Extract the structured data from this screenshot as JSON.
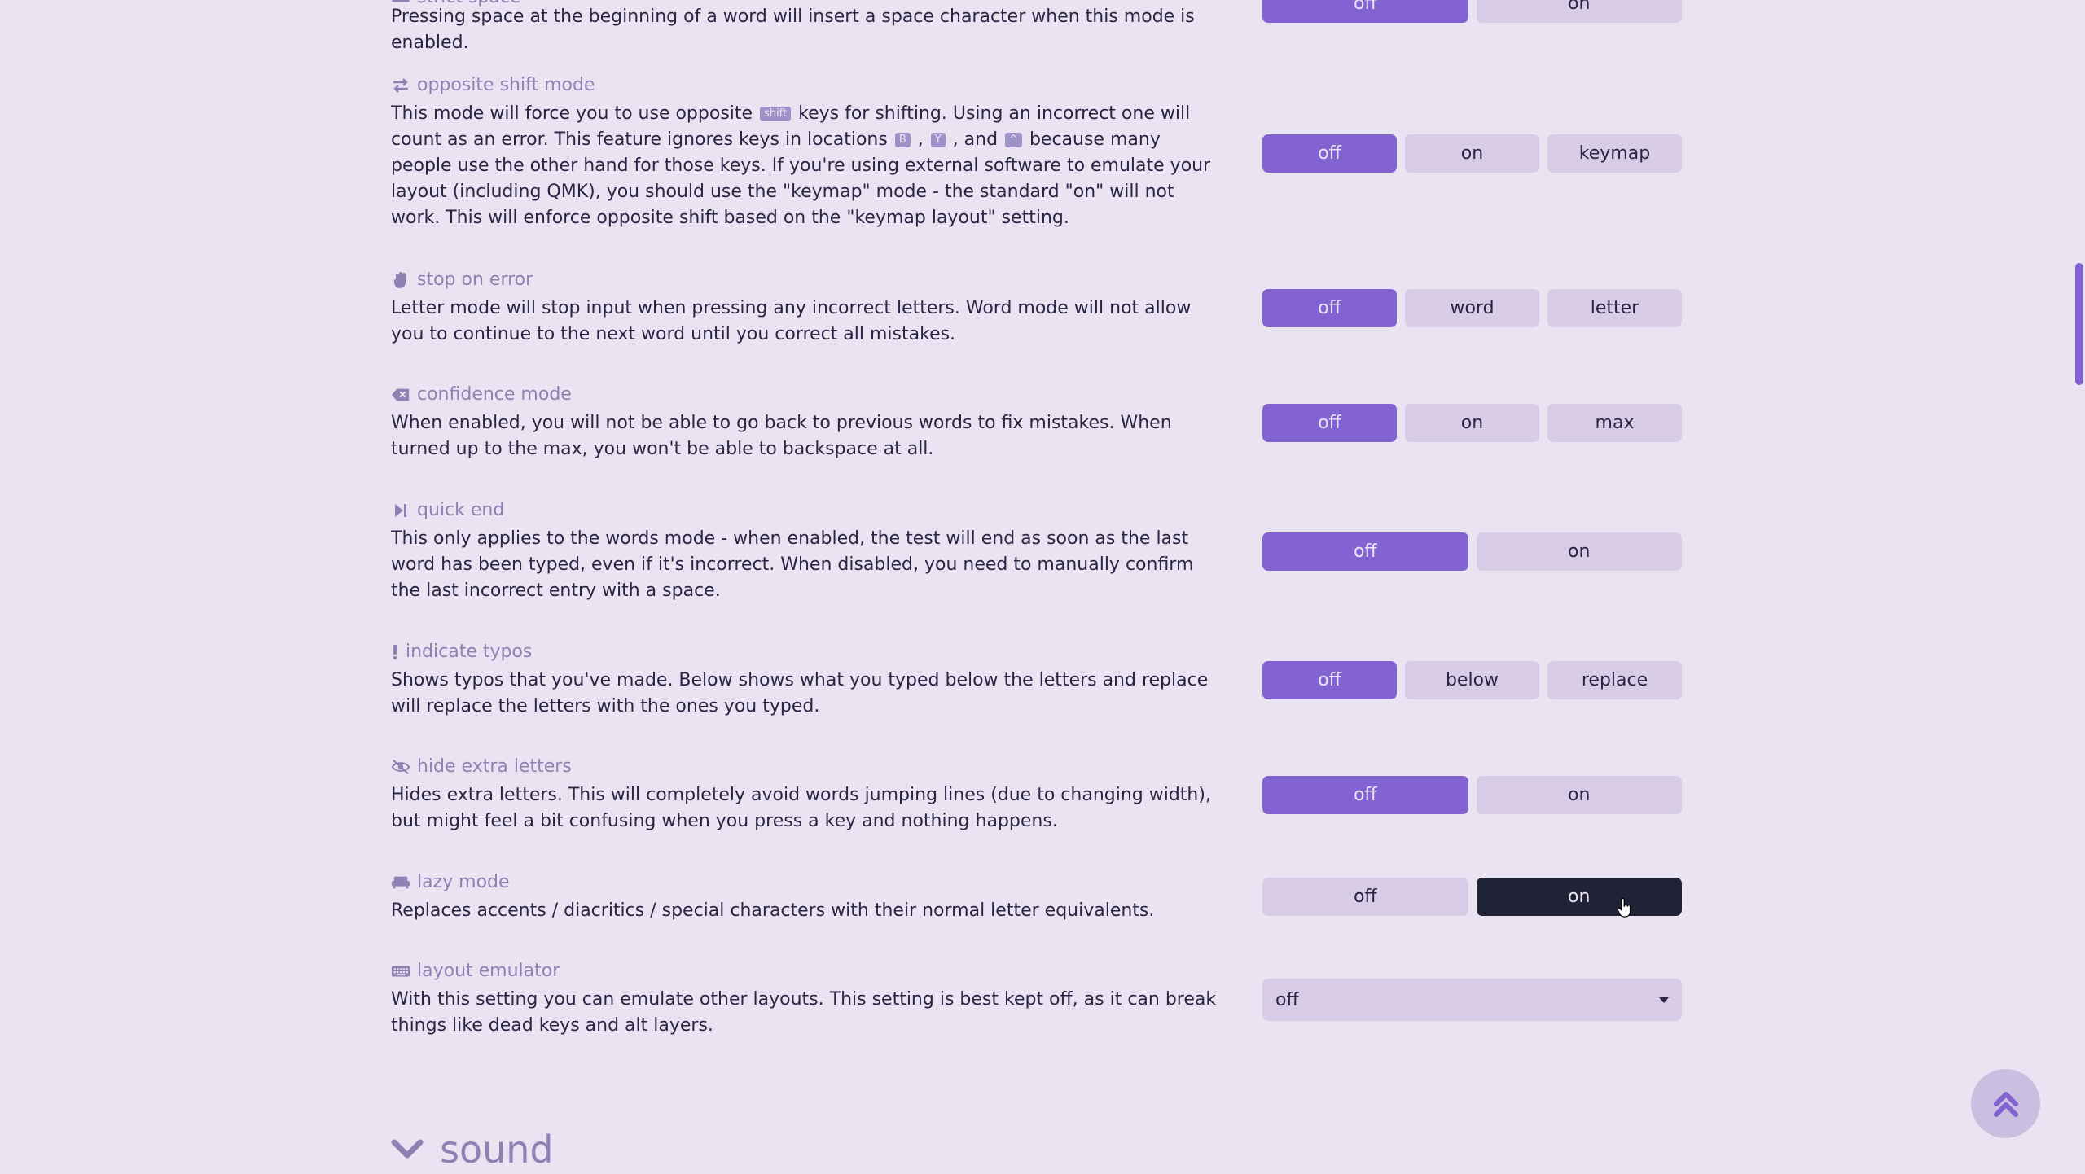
{
  "settings": [
    {
      "title": "strict space",
      "icon": "strict-space-icon",
      "description": "Pressing space at the beginning of a word will insert a space character when this mode is enabled.",
      "options": [
        "off",
        "on"
      ],
      "selected": "off"
    },
    {
      "title": "opposite shift mode",
      "icon": "opposite-arrows-icon",
      "description_parts": {
        "p1": "This mode will force you to use opposite ",
        "kbd_shift": "shift",
        "p2": " keys for shifting. Using an incorrect one will count as an error. This feature ignores keys in locations ",
        "kbd_b": "B",
        "sep1": " , ",
        "kbd_y": "Y",
        "sep2": " , and ",
        "kbd_caret": "^",
        "p3": " because many people use the other hand for those keys. If you're using external software to emulate your layout (including QMK), you should use the \"keymap\" mode - the standard \"on\" will not work. This will enforce opposite shift based on the \"keymap layout\" setting."
      },
      "options": [
        "off",
        "on",
        "keymap"
      ],
      "selected": "off"
    },
    {
      "title": "stop on error",
      "icon": "hand-icon",
      "description": "Letter mode will stop input when pressing any incorrect letters. Word mode will not allow you to continue to the next word until you correct all mistakes.",
      "options": [
        "off",
        "word",
        "letter"
      ],
      "selected": "off"
    },
    {
      "title": "confidence mode",
      "icon": "backspace-icon",
      "description": "When enabled, you will not be able to go back to previous words to fix mistakes. When turned up to the max, you won't be able to backspace at all.",
      "options": [
        "off",
        "on",
        "max"
      ],
      "selected": "off"
    },
    {
      "title": "quick end",
      "icon": "step-forward-icon",
      "description": "This only applies to the words mode - when enabled, the test will end as soon as the last word has been typed, even if it's incorrect. When disabled, you need to manually confirm the last incorrect entry with a space.",
      "options": [
        "off",
        "on"
      ],
      "selected": "off"
    },
    {
      "title": "indicate typos",
      "icon": "exclamation-icon",
      "description": "Shows typos that you've made. Below shows what you typed below the letters and replace will replace the letters with the ones you typed.",
      "options": [
        "off",
        "below",
        "replace"
      ],
      "selected": "off"
    },
    {
      "title": "hide extra letters",
      "icon": "eye-slash-icon",
      "description": "Hides extra letters. This will completely avoid words jumping lines (due to changing width), but might feel a bit confusing when you press a key and nothing happens.",
      "options": [
        "off",
        "on"
      ],
      "selected": "off"
    },
    {
      "title": "lazy mode",
      "icon": "couch-icon",
      "description": "Replaces accents / diacritics / special characters with their normal letter equivalents.",
      "options": [
        "off",
        "on"
      ],
      "selected": "on"
    },
    {
      "title": "layout emulator",
      "icon": "keyboard-icon",
      "description": "With this setting you can emulate other layouts. This setting is best kept off, as it can break things like dead keys and alt layers.",
      "select_value": "off"
    }
  ],
  "section": {
    "title": "sound",
    "icon": "chevron-down-icon"
  },
  "scroll_top_icon": "double-chevron-up-icon",
  "colors": {
    "background": "#eae4f2",
    "accent": "#8362d1",
    "button": "#d8cce6",
    "hover_dark": "#202336",
    "sub_text": "#8e82b4",
    "text": "#2a2445"
  }
}
